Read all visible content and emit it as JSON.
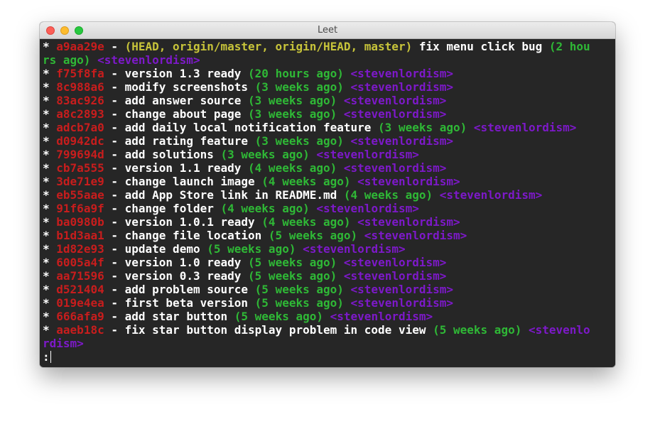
{
  "window": {
    "title": "Leet"
  },
  "terminal": {
    "first_commit": {
      "star": "*",
      "hash": "a9aa29e",
      "sep": " - ",
      "refs": "(HEAD, origin/master, origin/HEAD, master)",
      "message": " fix menu click bug ",
      "date_part1": "(2 hou",
      "date_part2": "rs ago)",
      "author": "<stevenlordism>"
    },
    "commits": [
      {
        "hash": "f75f8fa",
        "message": "version 1.3 ready",
        "date": "(20 hours ago)",
        "author": "<stevenlordism>"
      },
      {
        "hash": "8c988a6",
        "message": "modify screenshots",
        "date": "(3 weeks ago)",
        "author": "<stevenlordism>"
      },
      {
        "hash": "83ac926",
        "message": "add answer source",
        "date": "(3 weeks ago)",
        "author": "<stevenlordism>"
      },
      {
        "hash": "a8c2893",
        "message": "change about page",
        "date": "(3 weeks ago)",
        "author": "<stevenlordism>"
      },
      {
        "hash": "adcb7a0",
        "message": "add daily local notification feature",
        "date": "(3 weeks ago)",
        "author": "<stevenlordism>"
      },
      {
        "hash": "d0942dc",
        "message": "add rating feature",
        "date": "(3 weeks ago)",
        "author": "<stevenlordism>"
      },
      {
        "hash": "799694d",
        "message": "add solutions",
        "date": "(3 weeks ago)",
        "author": "<stevenlordism>"
      },
      {
        "hash": "cb7a555",
        "message": "version 1.1 ready",
        "date": "(4 weeks ago)",
        "author": "<stevenlordism>"
      },
      {
        "hash": "3de71e9",
        "message": "change launch image",
        "date": "(4 weeks ago)",
        "author": "<stevenlordism>"
      },
      {
        "hash": "eb55aae",
        "message": "add App Store link in README.md",
        "date": "(4 weeks ago)",
        "author": "<stevenlordism>"
      },
      {
        "hash": "91f6a9f",
        "message": "change folder",
        "date": "(4 weeks ago)",
        "author": "<stevenlordism>"
      },
      {
        "hash": "ba0980b",
        "message": "version 1.0.1 ready",
        "date": "(4 weeks ago)",
        "author": "<stevenlordism>"
      },
      {
        "hash": "b1d3aa1",
        "message": "change file location",
        "date": "(5 weeks ago)",
        "author": "<stevenlordism>"
      },
      {
        "hash": "1d82e93",
        "message": "update demo",
        "date": "(5 weeks ago)",
        "author": "<stevenlordism>"
      },
      {
        "hash": "6005a4f",
        "message": "version 1.0 ready",
        "date": "(5 weeks ago)",
        "author": "<stevenlordism>"
      },
      {
        "hash": "aa71596",
        "message": "version 0.3 ready",
        "date": "(5 weeks ago)",
        "author": "<stevenlordism>"
      },
      {
        "hash": "d521404",
        "message": "add problem source",
        "date": "(5 weeks ago)",
        "author": "<stevenlordism>"
      },
      {
        "hash": "019e4ea",
        "message": "first beta version",
        "date": "(5 weeks ago)",
        "author": "<stevenlordism>"
      },
      {
        "hash": "666afa9",
        "message": "add star button",
        "date": "(5 weeks ago)",
        "author": "<stevenlordism>"
      }
    ],
    "last_commit": {
      "star": "*",
      "hash": "aaeb18c",
      "sep": " - ",
      "message": "fix star button display problem in code view ",
      "date": "(5 weeks ago)",
      "author_part1": " <stevenlo",
      "author_part2": "rdism>"
    },
    "prompt": ":"
  },
  "colors": {
    "background": "#262626",
    "hash": "#c81d1d",
    "refs": "#c7c43a",
    "date": "#2fb836",
    "author": "#7d19c9",
    "text": "#ffffff"
  }
}
